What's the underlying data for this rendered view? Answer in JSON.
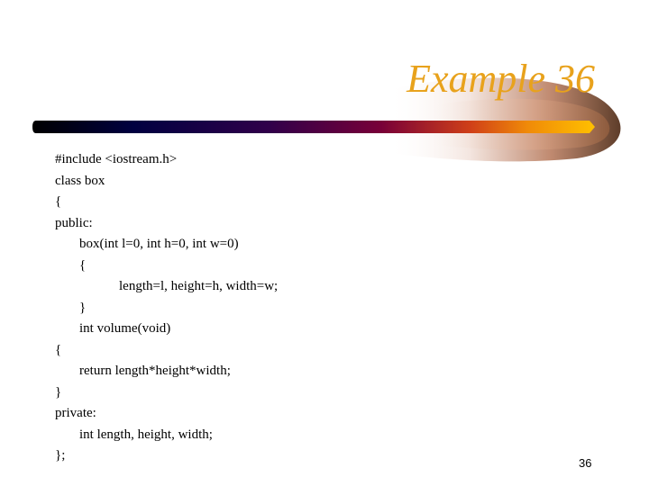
{
  "slide": {
    "title": "Example 36",
    "page_number": "36",
    "colors": {
      "title": "#e8a21c",
      "bar_start": "#000000",
      "bar_mid": "#000044",
      "bar_purple": "#3a0040",
      "bar_maroon": "#7a0038",
      "bar_orange": "#e07010",
      "bar_end": "#ffc000",
      "swoosh_brown": "#6b4a35"
    },
    "code_lines": [
      {
        "text": "#include <iostream.h>",
        "indent": 0
      },
      {
        "text": "class box",
        "indent": 0
      },
      {
        "text": "{",
        "indent": 0
      },
      {
        "text": "public:",
        "indent": 0
      },
      {
        "text": "box(int l=0, int h=0, int w=0)",
        "indent": 1
      },
      {
        "text": "{",
        "indent": 1
      },
      {
        "text": "length=l, height=h, width=w;",
        "indent": 2
      },
      {
        "text": "}",
        "indent": 1
      },
      {
        "text": "int volume(void)",
        "indent": 1
      },
      {
        "text": "{",
        "indent": 0
      },
      {
        "text": "return length*height*width;",
        "indent": 1
      },
      {
        "text": "}",
        "indent": 0
      },
      {
        "text": "private:",
        "indent": 0
      },
      {
        "text": "int length, height, width;",
        "indent": 1
      },
      {
        "text": "};",
        "indent": 0
      }
    ]
  }
}
